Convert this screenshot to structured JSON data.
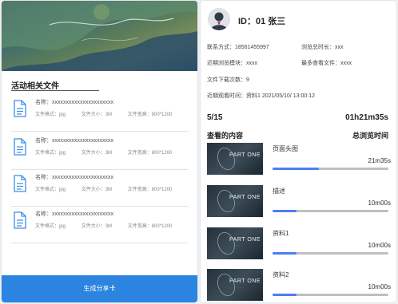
{
  "left": {
    "section_title": "活动相关文件",
    "files": [
      {
        "name": "名称：xxxxxxxxxxxxxxxxxxxxxx",
        "format": "文件格式：jpg",
        "size": "文件大小：3M",
        "dims": "文件宽高：800*1200"
      },
      {
        "name": "名称：xxxxxxxxxxxxxxxxxxxxxx",
        "format": "文件格式：jpg",
        "size": "文件大小：3M",
        "dims": "文件宽高：800*1200"
      },
      {
        "name": "名称：xxxxxxxxxxxxxxxxxxxxxx",
        "format": "文件格式：jpg",
        "size": "文件大小：3M",
        "dims": "文件宽高：800*1200"
      },
      {
        "name": "名称：xxxxxxxxxxxxxxxxxxxxxx",
        "format": "文件格式：jpg",
        "size": "文件大小：3M",
        "dims": "文件宽高：800*1200"
      }
    ],
    "generate_button": "生成分享卡",
    "file_icon": "document-icon"
  },
  "right": {
    "user_id": "ID：01 张三",
    "avatar_icon": "user-avatar-icon",
    "contact": "联系方式：18561455997",
    "total_duration": "浏览总时长：xxx",
    "recent_module": "近期浏览模块：xxxx",
    "most_viewed": "最多查看文件：xxxx",
    "download_count": "文件下载次数：9",
    "recent_view": "近期观看时间：资料1  2021/05/10/ 13:00:12",
    "progress": "5/15",
    "total_time": "01h21m35s",
    "viewed_heading": "查看的内容",
    "duration_heading": "总浏览时间",
    "items": [
      {
        "title": "页面头图",
        "time": "21m35s",
        "progress": 0.4,
        "thumb_title": "PART ONE",
        "thumb_sub": "◦ ◦ ◦ ◦ ◦ ◦"
      },
      {
        "title": "描述",
        "time": "10m00s",
        "progress": 0.21,
        "thumb_title": "PART ONE",
        "thumb_sub": "◦ ◦ ◦ ◦ ◦ ◦"
      },
      {
        "title": "资料1",
        "time": "10m00s",
        "progress": 0.21,
        "thumb_title": "PART ONE",
        "thumb_sub": "◦ ◦ ◦ ◦ ◦ ◦"
      },
      {
        "title": "资料2",
        "time": "10m00s",
        "progress": 0.21,
        "thumb_title": "PART ONE",
        "thumb_sub": "◦ ◦ ◦ ◦ ◦ ◦"
      }
    ]
  },
  "colors": {
    "accent": "#2a84e0",
    "progress_fill": "#4c7ef0",
    "progress_track": "#bfbfbf"
  }
}
